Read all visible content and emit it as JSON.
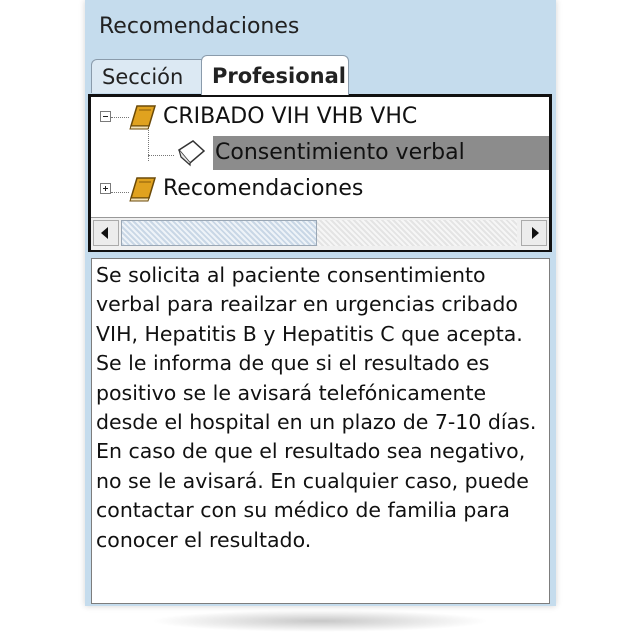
{
  "panel": {
    "title": "Recomendaciones"
  },
  "tabs": [
    {
      "label": "Sección",
      "active": false
    },
    {
      "label": "Profesional",
      "active": true
    }
  ],
  "tree": {
    "items": [
      {
        "label": "CRIBADO VIH VHB VHC",
        "icon": "book-icon",
        "expanded": true,
        "level": 0
      },
      {
        "label": "Consentimiento verbal",
        "icon": "page-icon",
        "selected": true,
        "level": 1
      },
      {
        "label": "Recomendaciones",
        "icon": "book-icon",
        "expanded": false,
        "level": 0
      }
    ]
  },
  "description": {
    "text": "Se solicita al paciente consentimiento verbal para reailzar en urgencias cribado VIH, Hepatitis B y Hepatitis C que acepta. Se le informa de que si el resultado es positivo se le avisará telefónicamente desde el hospital en un plazo de 7-10 días. En caso de que el resultado sea negativo, no se le avisará. En cualquier caso, puede contactar con su médico de familia para conocer el resultado."
  },
  "colors": {
    "panel_bg": "#c5dced",
    "selection_bg": "#8c8c8c",
    "book": "#c98a16"
  }
}
